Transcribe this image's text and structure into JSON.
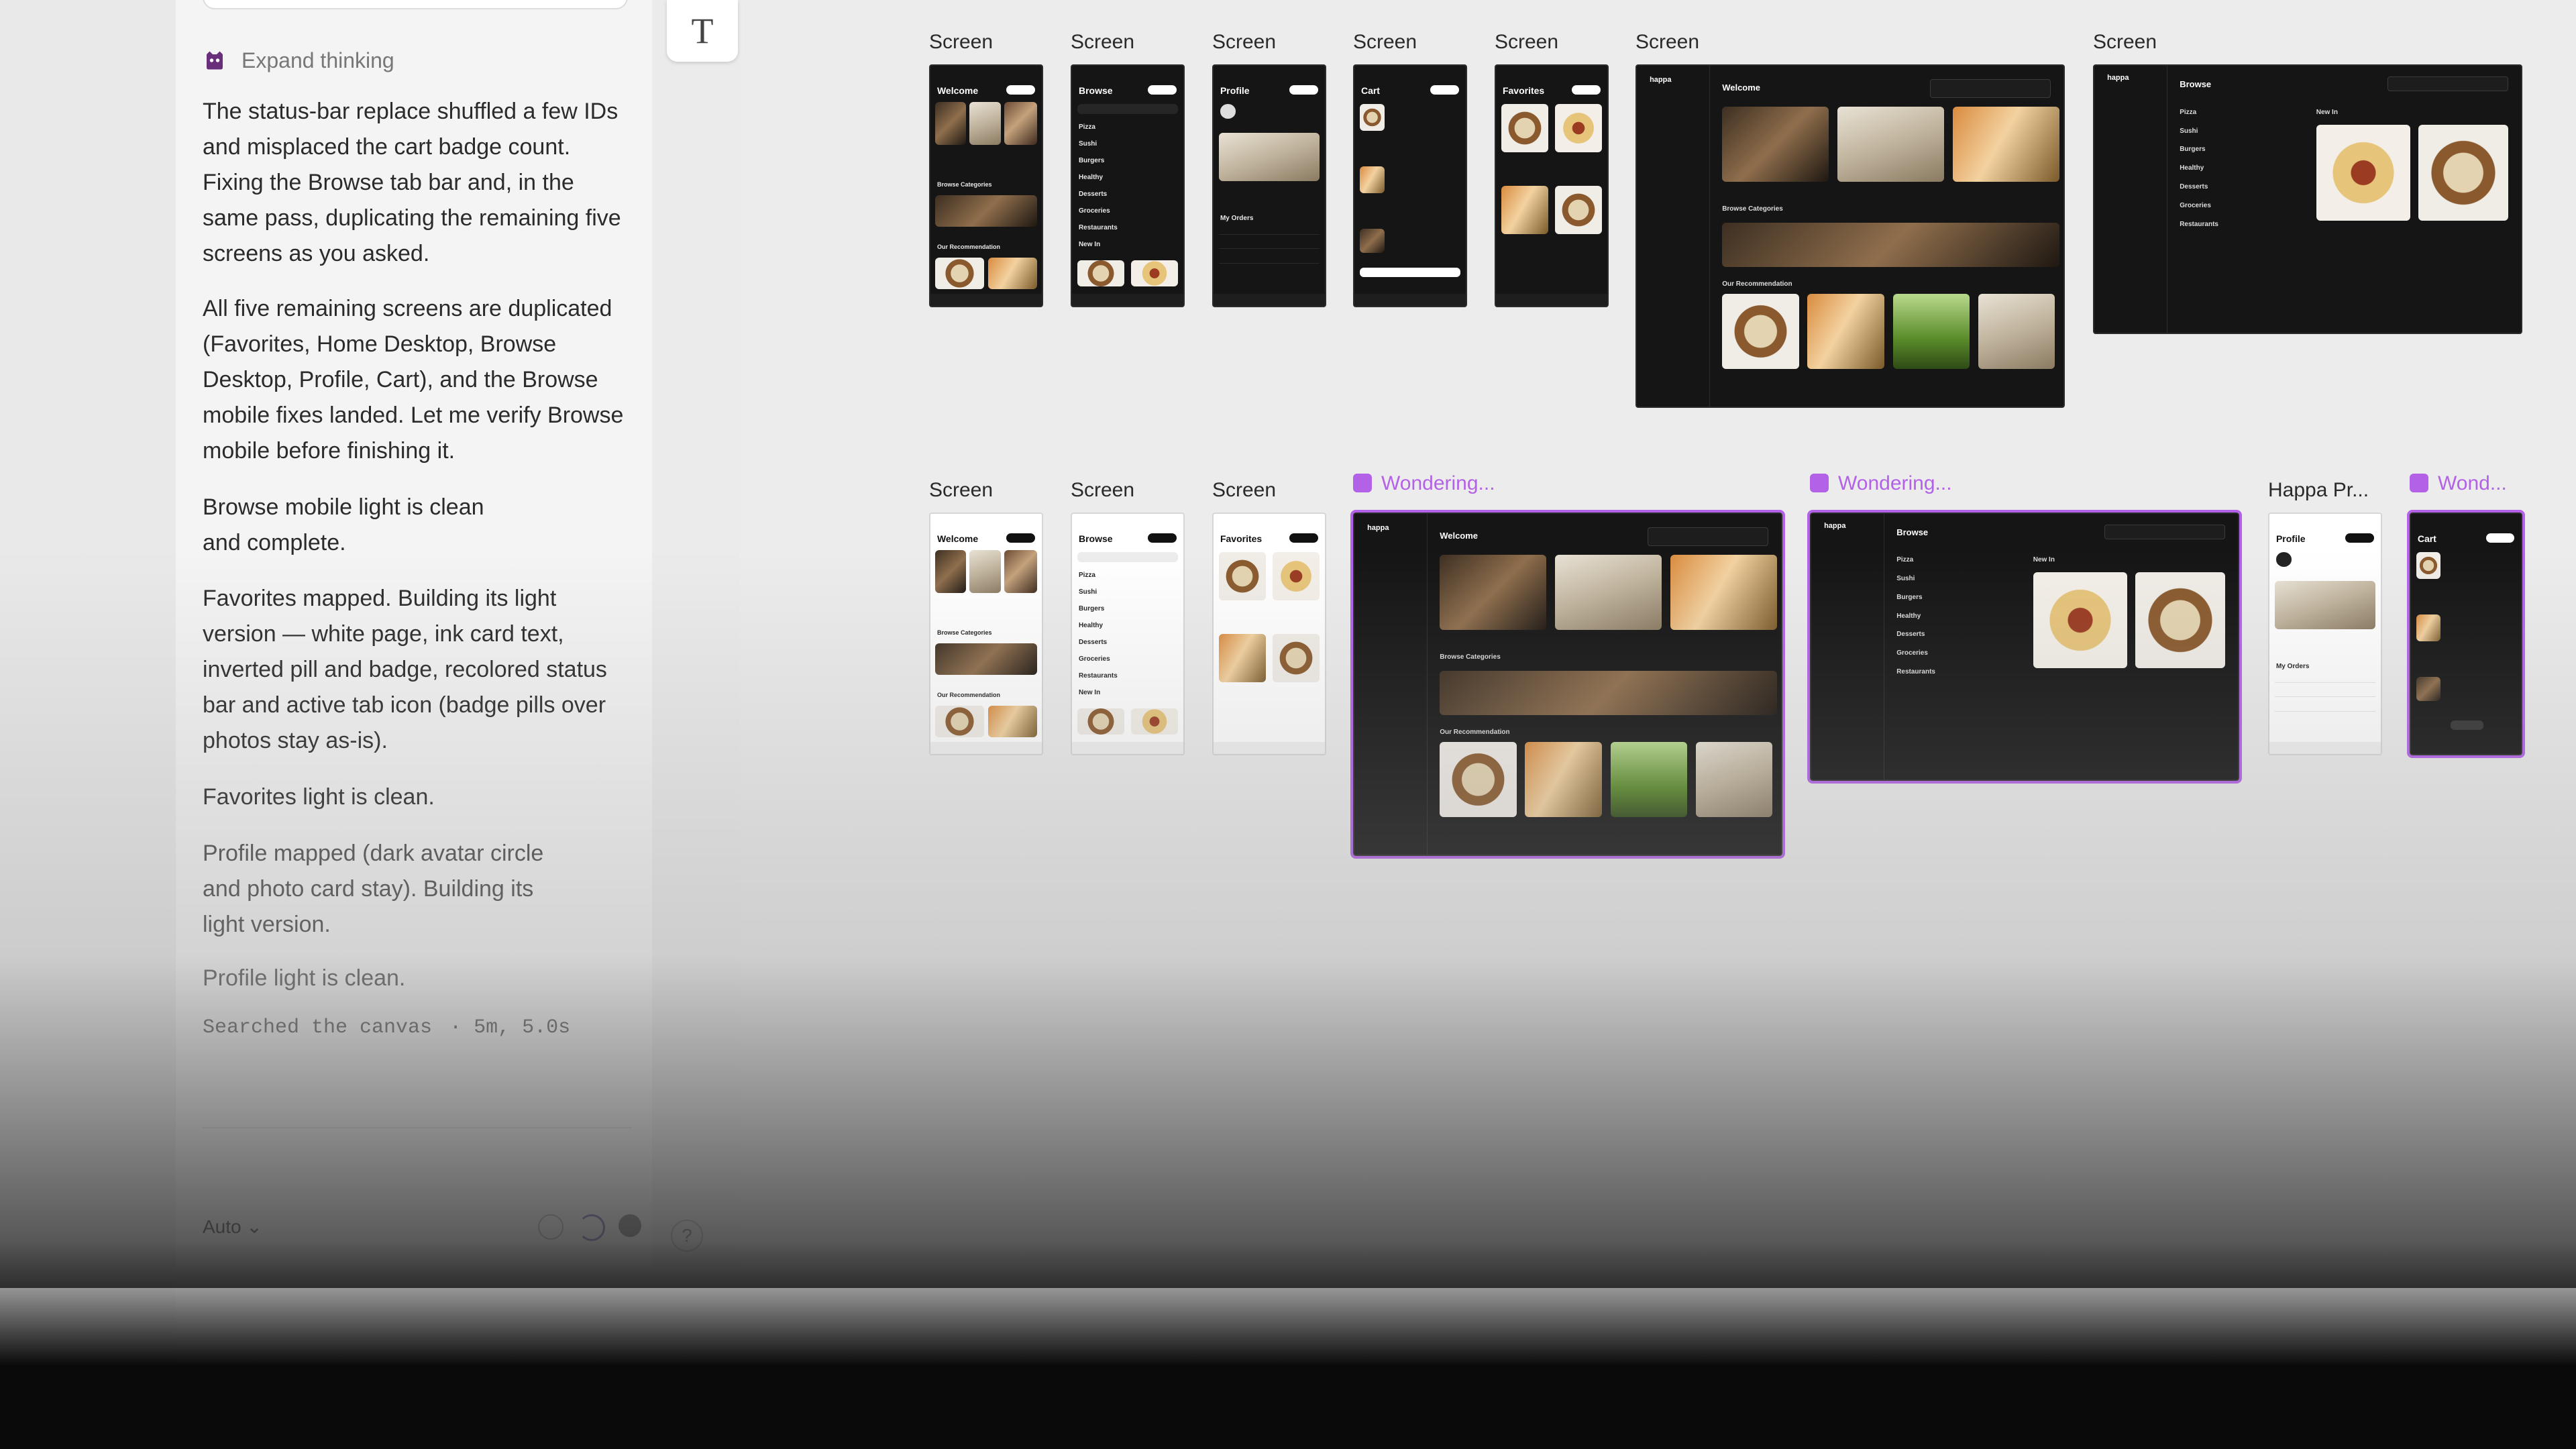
{
  "chat": {
    "expand_label": "Expand thinking",
    "paragraphs": [
      "The status-bar replace shuffled a few IDs and misplaced the cart badge count. Fixing the Browse tab bar and, in the same pass, duplicating the remaining five screens as you asked.",
      "All five remaining screens are duplicated (Favorites, Home Desktop, Browse Desktop, Profile, Cart), and the Browse mobile fixes landed. Let me verify Browse mobile before finishing it.",
      "Browse mobile light is clean and complete.",
      "Favorites mapped. Building its light version — white page, ink card text, inverted pill and badge, recolored status bar and active tab icon (badge pills over photos stay as-is).",
      "Favorites light is clean.",
      "Profile mapped (dark avatar circle and photo card stay). Building its light version.",
      "Profile light is clean."
    ],
    "activity": "Searched the canvas",
    "activity_duration": "· 5m, 5.0s",
    "model_label": "Auto"
  },
  "toolbar": {
    "text_tool": "T",
    "help": "?"
  },
  "frames": {
    "row1": [
      "Screen",
      "Screen",
      "Screen",
      "Screen",
      "Screen",
      "Screen",
      "Screen"
    ],
    "row2": [
      "Screen",
      "Screen",
      "Screen"
    ],
    "wondering_1": "Wondering...",
    "wondering_2": "Wondering...",
    "wondering_3": "Wond...",
    "happa_profile": "Happa Pr..."
  },
  "screens": {
    "welcome": "Welcome",
    "browse": "Browse",
    "profile": "Profile",
    "cart": "Cart",
    "favorites": "Favorites",
    "happa": "happa",
    "browse_categories": "Browse Categories",
    "our_recommendation": "Our Recommendation",
    "new_in": "New In",
    "my_orders": "My Orders",
    "categories": [
      "Pizza",
      "Sushi",
      "Burgers",
      "Healthy",
      "Desserts",
      "Groceries",
      "Restaurants",
      "New In"
    ]
  },
  "colors": {
    "accent_purple": "#b362e8"
  }
}
